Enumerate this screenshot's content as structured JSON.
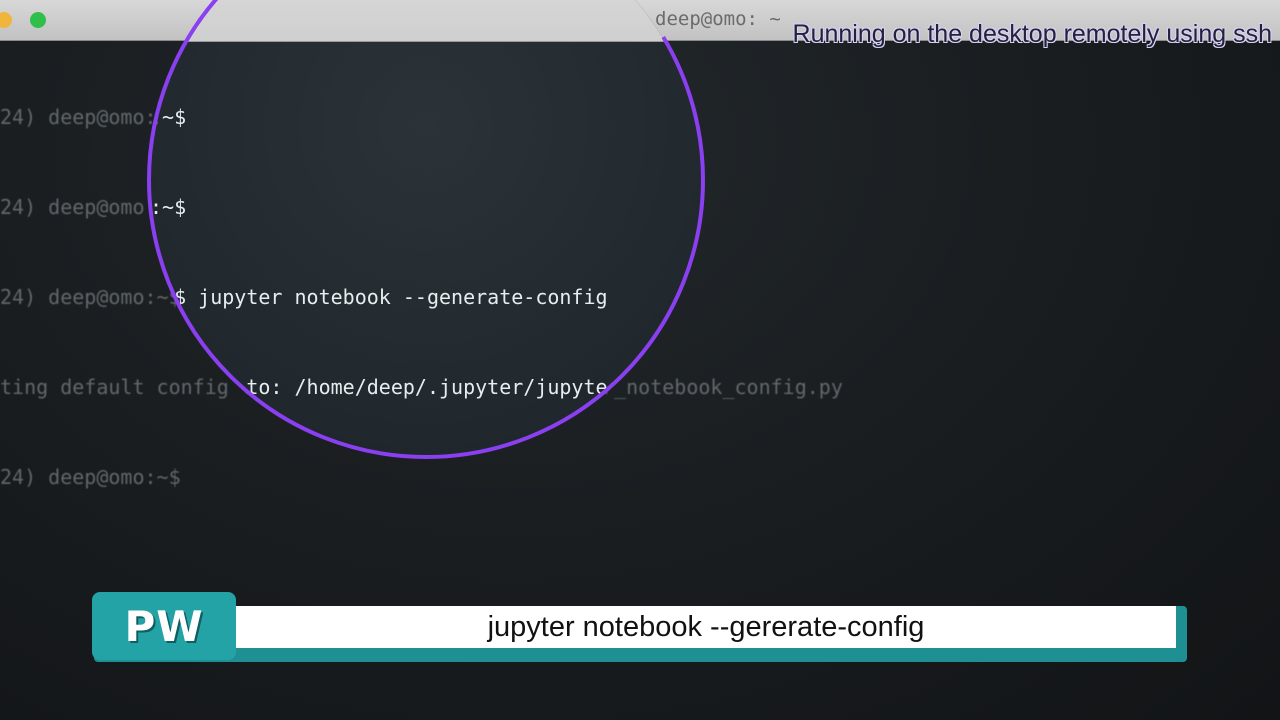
{
  "window": {
    "title": "deep@omo: ~"
  },
  "terminal": {
    "lines": [
      "24) deep@omo:~$",
      "24) deep@omo:~$",
      "24) deep@omo:~$ jupyter notebook --generate-config",
      "ting default config to: /home/deep/.jupyter/jupyter_notebook_config.py",
      "24) deep@omo:~$ "
    ]
  },
  "magnifier": {
    "lines": [
      ":~$",
      ":~$",
      ":~$ jupyter notebook --generate-config",
      " config to: /home/deep/.jupyter/jupyter_note",
      ":~$ "
    ]
  },
  "overlay": {
    "caption": "Running on the desktop remotely using ssh"
  },
  "banner": {
    "logo": "PW",
    "text": "jupyter notebook --gererate-config"
  },
  "colors": {
    "ring": "#8a3ff0",
    "banner": "#24a3a6"
  }
}
